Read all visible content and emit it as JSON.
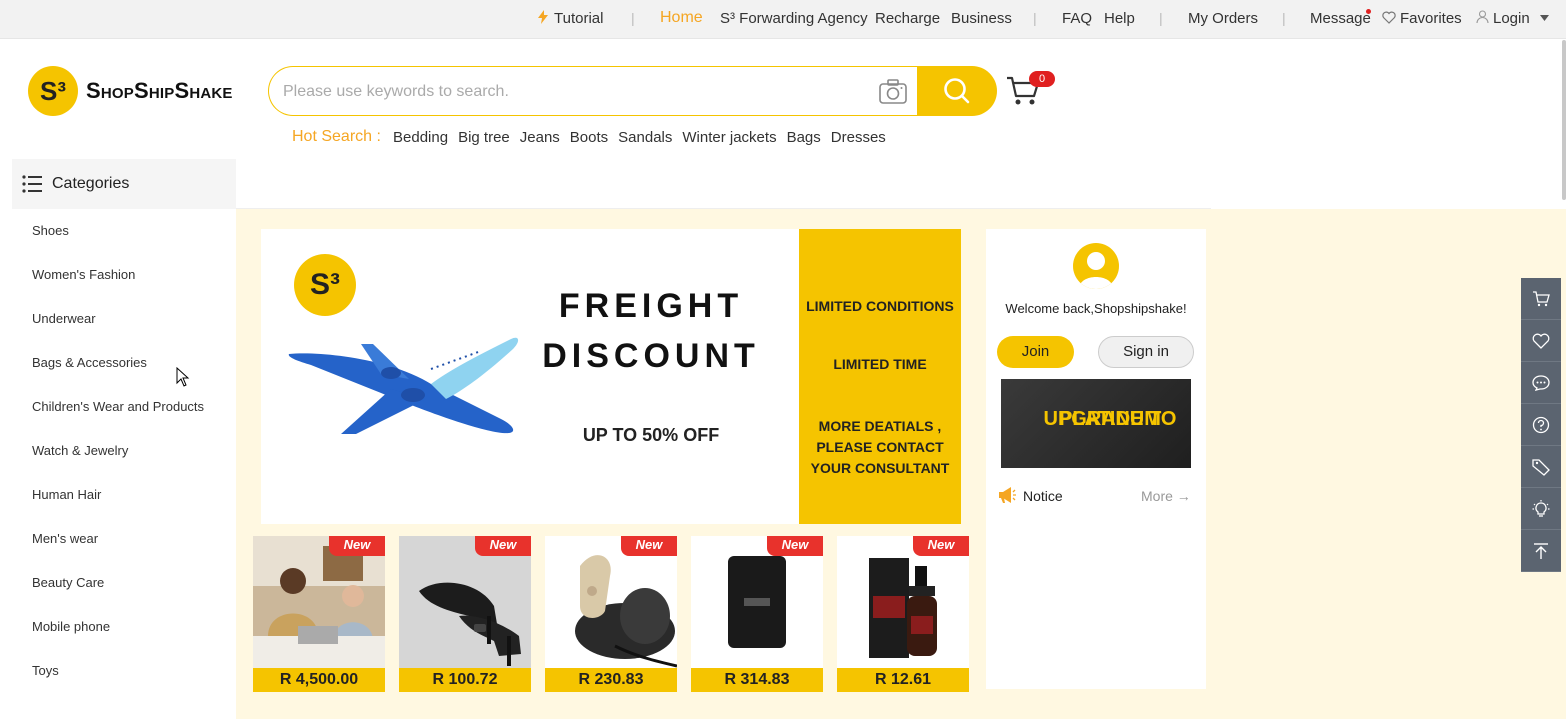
{
  "topbar": {
    "tutorial": "Tutorial",
    "home": "Home",
    "forwarding": "S³ Forwarding Agency",
    "recharge": "Recharge",
    "business": "Business",
    "faq": "FAQ",
    "help": "Help",
    "my_orders": "My Orders",
    "message": "Message",
    "favorites": "Favorites",
    "login": "Login",
    "separator": "|"
  },
  "header": {
    "logo_mark": "S³",
    "logo_text": "ShopShipShake",
    "search_placeholder": "Please use keywords to search.",
    "cart_count": "0"
  },
  "hot_search": {
    "label": "Hot Search :",
    "terms": [
      "Bedding",
      "Big tree",
      "Jeans",
      "Boots",
      "Sandals",
      "Winter jackets",
      "Bags",
      "Dresses"
    ]
  },
  "categories": {
    "title": "Categories",
    "items": [
      "Shoes",
      "Women's Fashion",
      "Underwear",
      "Bags & Accessories",
      "Children's Wear and Products",
      "Watch & Jewelry",
      "Human Hair",
      "Men's wear",
      "Beauty Care",
      "Mobile phone",
      "Toys"
    ]
  },
  "banner": {
    "logo_mark": "S³",
    "title_line1": "FREIGHT",
    "title_line2": "DISCOUNT",
    "subtitle": "UP TO 50% OFF",
    "side1": "LIMITED CONDITIONS",
    "side2": "LIMITED TIME",
    "side3_l1": "MORE DEATIALS ,",
    "side3_l2": "PLEASE CONTACT",
    "side3_l3": "YOUR CONSULTANT"
  },
  "products": [
    {
      "badge": "New",
      "price": "R 4,500.00"
    },
    {
      "badge": "New",
      "price": "R 100.72"
    },
    {
      "badge": "New",
      "price": "R 230.83"
    },
    {
      "badge": "New",
      "price": "R 314.83"
    },
    {
      "badge": "New",
      "price": "R 12.61"
    }
  ],
  "user_card": {
    "welcome": "Welcome back,Shopshipshake!",
    "join": "Join",
    "sign_in": "Sign in",
    "upgrade_l1": "UPGRADE TO",
    "upgrade_l2": "PLATINUM",
    "notice": "Notice",
    "more": "More →"
  },
  "right_rail": [
    "cart-icon",
    "heart-icon",
    "chat-icon",
    "help-icon",
    "tag-icon",
    "bulb-icon",
    "back-to-top-icon"
  ],
  "colors": {
    "accent": "#f5c400",
    "accent_text": "#f5a623",
    "badge_red": "#e8322c",
    "rail": "#5b6470",
    "page_bg": "#fff8e1"
  }
}
